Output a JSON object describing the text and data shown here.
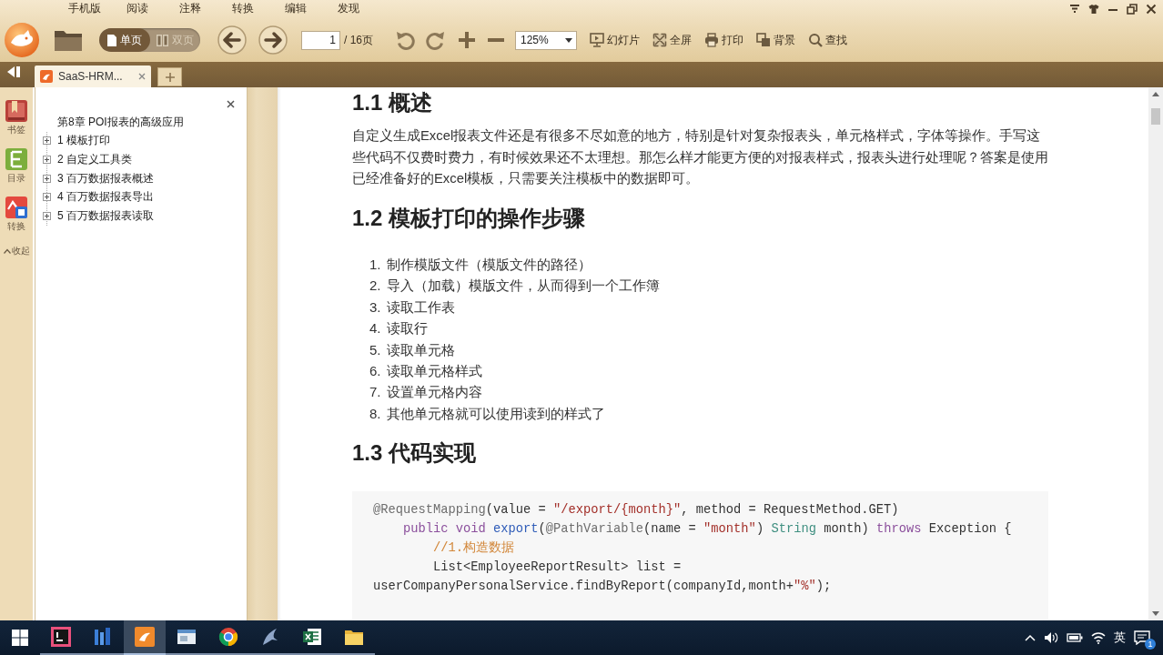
{
  "menu_bar": {
    "items": [
      "手机版",
      "阅读",
      "注释",
      "转换",
      "编辑",
      "发现"
    ]
  },
  "toolbar": {
    "view_modes": [
      {
        "label": "单页",
        "selected": true
      },
      {
        "label": "双页",
        "selected": false
      }
    ],
    "page_field": {
      "value": "1",
      "total": "/ 16页"
    },
    "zoom_select": {
      "value": "125%"
    },
    "tools": [
      "幻灯片",
      "全屏",
      "打印",
      "背景",
      "查找"
    ]
  },
  "tabs": [
    {
      "title": "SaaS-HRM...",
      "selected": true
    }
  ],
  "side_rail": {
    "items": [
      "书签",
      "目录",
      "转换"
    ],
    "collapse_label": "收起"
  },
  "outline": {
    "items": [
      {
        "label": "第8章 POI报表的高级应用",
        "children": [
          {
            "label": "1 模板打印",
            "expanded": false
          },
          {
            "label": "2 自定义工具类",
            "expanded": false
          },
          {
            "label": "3 百万数据报表概述",
            "expanded": false
          },
          {
            "label": "4 百万数据报表导出",
            "expanded": false
          },
          {
            "label": "5 百万数据报表读取",
            "expanded": false
          }
        ]
      }
    ]
  },
  "document": {
    "blocks": [
      {
        "kind": "heading",
        "text": "1.1 概述"
      },
      {
        "kind": "paragraph",
        "text": "自定义生成Excel报表文件还是有很多不尽如意的地方，特别是针对复杂报表头，单元格样式，字体等操作。手写这些代码不仅费时费力，有时候效果还不太理想。那怎么样才能更方便的对报表样式，报表头进行处理呢？答案是使用已经准备好的Excel模板，只需要关注模板中的数据即可。"
      },
      {
        "kind": "heading",
        "text": "1.2 模板打印的操作步骤"
      },
      {
        "kind": "list",
        "items": [
          {
            "number": "1.",
            "text": "制作模版文件（模版文件的路径）"
          },
          {
            "number": "2.",
            "text": "导入（加载）模版文件，从而得到一个工作簿"
          },
          {
            "number": "3.",
            "text": "读取工作表"
          },
          {
            "number": "4.",
            "text": "读取行"
          },
          {
            "number": "5.",
            "text": "读取单元格"
          },
          {
            "number": "6.",
            "text": "读取单元格样式"
          },
          {
            "number": "7.",
            "text": "设置单元格内容"
          },
          {
            "number": "8.",
            "text": "其他单元格就可以使用读到的样式了"
          }
        ]
      },
      {
        "kind": "heading",
        "text": "1.3 代码实现"
      },
      {
        "kind": "code",
        "lines": [
          [
            {
              "text": "@RequestMapping",
              "kind": "annotation"
            },
            {
              "text": "(value = ",
              "kind": "plain"
            },
            {
              "text": "\"/export/{month}\"",
              "kind": "string"
            },
            {
              "text": ", method = RequestMethod.GET)",
              "kind": "plain"
            }
          ],
          [
            {
              "text": "    public void ",
              "kind": "keyword"
            },
            {
              "text": "export",
              "kind": "function"
            },
            {
              "text": "(",
              "kind": "plain"
            },
            {
              "text": "@PathVariable",
              "kind": "annotation"
            },
            {
              "text": "(name = ",
              "kind": "plain"
            },
            {
              "text": "\"month\"",
              "kind": "string"
            },
            {
              "text": ") ",
              "kind": "plain"
            },
            {
              "text": "String",
              "kind": "type"
            },
            {
              "text": " month) ",
              "kind": "plain"
            },
            {
              "text": "throws",
              "kind": "keyword"
            },
            {
              "text": " Exception {",
              "kind": "plain"
            }
          ],
          [
            {
              "text": "        //1.构造数据",
              "kind": "comment"
            }
          ],
          [
            {
              "text": "        List<EmployeeReportResult> list =",
              "kind": "plain"
            }
          ],
          [
            {
              "text": "userCompanyPersonalService.findByReport(companyId,month+",
              "kind": "plain"
            },
            {
              "text": "\"%\"",
              "kind": "string"
            },
            {
              "text": ");",
              "kind": "plain"
            }
          ]
        ]
      }
    ]
  },
  "taskbar": {
    "apps": [
      {
        "selected": false
      },
      {
        "selected": false
      },
      {
        "selected": true
      },
      {
        "selected": false
      },
      {
        "selected": false
      },
      {
        "selected": false
      },
      {
        "selected": false
      },
      {
        "selected": false
      }
    ],
    "language": "英",
    "notification_count": "1"
  }
}
